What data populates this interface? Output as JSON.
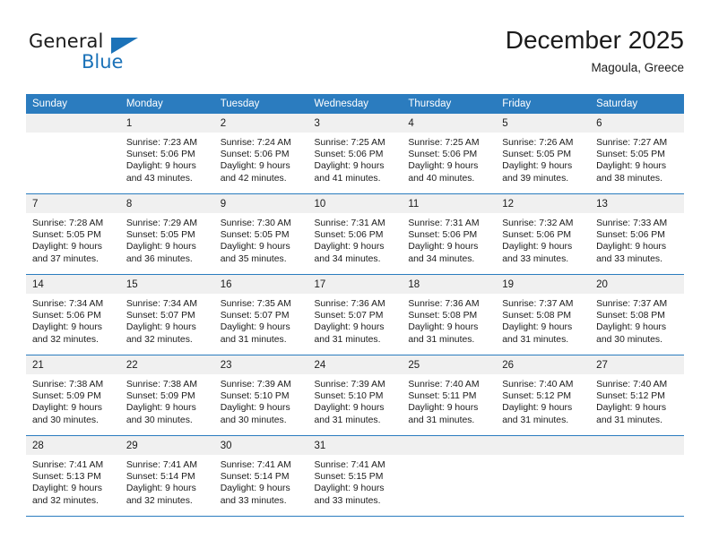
{
  "brand": {
    "name_dark": "General",
    "name_blue": "Blue",
    "triangle_color": "#1b72b8"
  },
  "header": {
    "title": "December 2025",
    "location": "Magoula, Greece",
    "accent_color": "#2b7cbf",
    "daynum_band_color": "#f0f0f0"
  },
  "weekday_headers": [
    "Sunday",
    "Monday",
    "Tuesday",
    "Wednesday",
    "Thursday",
    "Friday",
    "Saturday"
  ],
  "weeks": [
    [
      {
        "day": "",
        "sunrise": "",
        "sunset": "",
        "daylight1": "",
        "daylight2": ""
      },
      {
        "day": "1",
        "sunrise": "Sunrise: 7:23 AM",
        "sunset": "Sunset: 5:06 PM",
        "daylight1": "Daylight: 9 hours",
        "daylight2": "and 43 minutes."
      },
      {
        "day": "2",
        "sunrise": "Sunrise: 7:24 AM",
        "sunset": "Sunset: 5:06 PM",
        "daylight1": "Daylight: 9 hours",
        "daylight2": "and 42 minutes."
      },
      {
        "day": "3",
        "sunrise": "Sunrise: 7:25 AM",
        "sunset": "Sunset: 5:06 PM",
        "daylight1": "Daylight: 9 hours",
        "daylight2": "and 41 minutes."
      },
      {
        "day": "4",
        "sunrise": "Sunrise: 7:25 AM",
        "sunset": "Sunset: 5:06 PM",
        "daylight1": "Daylight: 9 hours",
        "daylight2": "and 40 minutes."
      },
      {
        "day": "5",
        "sunrise": "Sunrise: 7:26 AM",
        "sunset": "Sunset: 5:05 PM",
        "daylight1": "Daylight: 9 hours",
        "daylight2": "and 39 minutes."
      },
      {
        "day": "6",
        "sunrise": "Sunrise: 7:27 AM",
        "sunset": "Sunset: 5:05 PM",
        "daylight1": "Daylight: 9 hours",
        "daylight2": "and 38 minutes."
      }
    ],
    [
      {
        "day": "7",
        "sunrise": "Sunrise: 7:28 AM",
        "sunset": "Sunset: 5:05 PM",
        "daylight1": "Daylight: 9 hours",
        "daylight2": "and 37 minutes."
      },
      {
        "day": "8",
        "sunrise": "Sunrise: 7:29 AM",
        "sunset": "Sunset: 5:05 PM",
        "daylight1": "Daylight: 9 hours",
        "daylight2": "and 36 minutes."
      },
      {
        "day": "9",
        "sunrise": "Sunrise: 7:30 AM",
        "sunset": "Sunset: 5:05 PM",
        "daylight1": "Daylight: 9 hours",
        "daylight2": "and 35 minutes."
      },
      {
        "day": "10",
        "sunrise": "Sunrise: 7:31 AM",
        "sunset": "Sunset: 5:06 PM",
        "daylight1": "Daylight: 9 hours",
        "daylight2": "and 34 minutes."
      },
      {
        "day": "11",
        "sunrise": "Sunrise: 7:31 AM",
        "sunset": "Sunset: 5:06 PM",
        "daylight1": "Daylight: 9 hours",
        "daylight2": "and 34 minutes."
      },
      {
        "day": "12",
        "sunrise": "Sunrise: 7:32 AM",
        "sunset": "Sunset: 5:06 PM",
        "daylight1": "Daylight: 9 hours",
        "daylight2": "and 33 minutes."
      },
      {
        "day": "13",
        "sunrise": "Sunrise: 7:33 AM",
        "sunset": "Sunset: 5:06 PM",
        "daylight1": "Daylight: 9 hours",
        "daylight2": "and 33 minutes."
      }
    ],
    [
      {
        "day": "14",
        "sunrise": "Sunrise: 7:34 AM",
        "sunset": "Sunset: 5:06 PM",
        "daylight1": "Daylight: 9 hours",
        "daylight2": "and 32 minutes."
      },
      {
        "day": "15",
        "sunrise": "Sunrise: 7:34 AM",
        "sunset": "Sunset: 5:07 PM",
        "daylight1": "Daylight: 9 hours",
        "daylight2": "and 32 minutes."
      },
      {
        "day": "16",
        "sunrise": "Sunrise: 7:35 AM",
        "sunset": "Sunset: 5:07 PM",
        "daylight1": "Daylight: 9 hours",
        "daylight2": "and 31 minutes."
      },
      {
        "day": "17",
        "sunrise": "Sunrise: 7:36 AM",
        "sunset": "Sunset: 5:07 PM",
        "daylight1": "Daylight: 9 hours",
        "daylight2": "and 31 minutes."
      },
      {
        "day": "18",
        "sunrise": "Sunrise: 7:36 AM",
        "sunset": "Sunset: 5:08 PM",
        "daylight1": "Daylight: 9 hours",
        "daylight2": "and 31 minutes."
      },
      {
        "day": "19",
        "sunrise": "Sunrise: 7:37 AM",
        "sunset": "Sunset: 5:08 PM",
        "daylight1": "Daylight: 9 hours",
        "daylight2": "and 31 minutes."
      },
      {
        "day": "20",
        "sunrise": "Sunrise: 7:37 AM",
        "sunset": "Sunset: 5:08 PM",
        "daylight1": "Daylight: 9 hours",
        "daylight2": "and 30 minutes."
      }
    ],
    [
      {
        "day": "21",
        "sunrise": "Sunrise: 7:38 AM",
        "sunset": "Sunset: 5:09 PM",
        "daylight1": "Daylight: 9 hours",
        "daylight2": "and 30 minutes."
      },
      {
        "day": "22",
        "sunrise": "Sunrise: 7:38 AM",
        "sunset": "Sunset: 5:09 PM",
        "daylight1": "Daylight: 9 hours",
        "daylight2": "and 30 minutes."
      },
      {
        "day": "23",
        "sunrise": "Sunrise: 7:39 AM",
        "sunset": "Sunset: 5:10 PM",
        "daylight1": "Daylight: 9 hours",
        "daylight2": "and 30 minutes."
      },
      {
        "day": "24",
        "sunrise": "Sunrise: 7:39 AM",
        "sunset": "Sunset: 5:10 PM",
        "daylight1": "Daylight: 9 hours",
        "daylight2": "and 31 minutes."
      },
      {
        "day": "25",
        "sunrise": "Sunrise: 7:40 AM",
        "sunset": "Sunset: 5:11 PM",
        "daylight1": "Daylight: 9 hours",
        "daylight2": "and 31 minutes."
      },
      {
        "day": "26",
        "sunrise": "Sunrise: 7:40 AM",
        "sunset": "Sunset: 5:12 PM",
        "daylight1": "Daylight: 9 hours",
        "daylight2": "and 31 minutes."
      },
      {
        "day": "27",
        "sunrise": "Sunrise: 7:40 AM",
        "sunset": "Sunset: 5:12 PM",
        "daylight1": "Daylight: 9 hours",
        "daylight2": "and 31 minutes."
      }
    ],
    [
      {
        "day": "28",
        "sunrise": "Sunrise: 7:41 AM",
        "sunset": "Sunset: 5:13 PM",
        "daylight1": "Daylight: 9 hours",
        "daylight2": "and 32 minutes."
      },
      {
        "day": "29",
        "sunrise": "Sunrise: 7:41 AM",
        "sunset": "Sunset: 5:14 PM",
        "daylight1": "Daylight: 9 hours",
        "daylight2": "and 32 minutes."
      },
      {
        "day": "30",
        "sunrise": "Sunrise: 7:41 AM",
        "sunset": "Sunset: 5:14 PM",
        "daylight1": "Daylight: 9 hours",
        "daylight2": "and 33 minutes."
      },
      {
        "day": "31",
        "sunrise": "Sunrise: 7:41 AM",
        "sunset": "Sunset: 5:15 PM",
        "daylight1": "Daylight: 9 hours",
        "daylight2": "and 33 minutes."
      },
      {
        "day": "",
        "sunrise": "",
        "sunset": "",
        "daylight1": "",
        "daylight2": ""
      },
      {
        "day": "",
        "sunrise": "",
        "sunset": "",
        "daylight1": "",
        "daylight2": ""
      },
      {
        "day": "",
        "sunrise": "",
        "sunset": "",
        "daylight1": "",
        "daylight2": ""
      }
    ]
  ]
}
